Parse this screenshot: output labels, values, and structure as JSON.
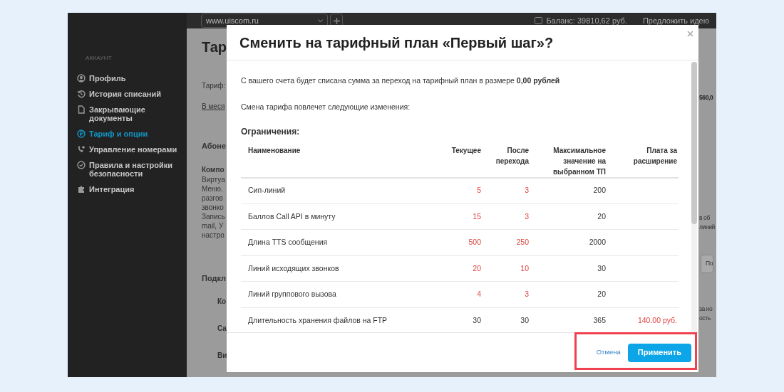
{
  "sidebar": {
    "section": "АККАУНТ",
    "items": [
      {
        "label": "Профиль",
        "kind": "profile",
        "selected": false
      },
      {
        "label": "История списаний",
        "kind": "history",
        "selected": false
      },
      {
        "label": "Закрывающие документы",
        "kind": "document",
        "selected": false
      },
      {
        "label": "Тариф и опции",
        "kind": "tariff",
        "selected": true
      },
      {
        "label": "Управление номерами",
        "kind": "phone",
        "selected": false
      },
      {
        "label": "Правила и настройки безопасности",
        "kind": "shield",
        "selected": false
      },
      {
        "label": "Интеграция",
        "kind": "integration",
        "selected": false
      }
    ]
  },
  "top_bar": {
    "site_select": "www.uiscom.ru",
    "balance": "Баланс: 39810,62 руб.",
    "idea_link": "Предложить идею"
  },
  "background_page": {
    "left_texts": [
      {
        "text": "Тар",
        "kind": "heading"
      },
      {
        "text": "Тариф:",
        "kind": "label"
      },
      {
        "text": "В меся",
        "kind": "link"
      },
      {
        "text": "Абоне",
        "kind": "subheading"
      },
      {
        "text": "Компо",
        "kind": "bold"
      },
      {
        "text": "Виртуа",
        "kind": "line"
      },
      {
        "text": "Меню.",
        "kind": "line"
      },
      {
        "text": "разгов",
        "kind": "line"
      },
      {
        "text": "звонко",
        "kind": "line"
      },
      {
        "text": "Запись",
        "kind": "line"
      },
      {
        "text": "mail, У",
        "kind": "line"
      },
      {
        "text": "настро",
        "kind": "line"
      },
      {
        "text": "Подкл",
        "kind": "subheading"
      },
      {
        "text": "Ко",
        "kind": "option"
      },
      {
        "text": "Са",
        "kind": "option"
      },
      {
        "text": "Ви",
        "kind": "option"
      }
    ],
    "right_texts": [
      {
        "text": "560,0",
        "kind": "price"
      },
      {
        "text": "в об",
        "kind": "line"
      },
      {
        "text": "линий",
        "kind": "line"
      },
      {
        "text": "По",
        "kind": "button"
      },
      {
        "text": "за но",
        "kind": "line"
      },
      {
        "text": "ость",
        "kind": "line"
      }
    ]
  },
  "dialog": {
    "title": "Сменить на тарифный план «Первый шаг»?",
    "message": "С вашего счета будет списана сумма за переход на тарифный план в размере **0,00 рублей**",
    "changes_note": "Смена тарифа повлечет следующие изменения:",
    "section": "Ограничения:",
    "table": {
      "columns": [
        "Наименование",
        "Текущее",
        "После перехода",
        "Максимальное значение на выбранном ТП",
        "Плата за расширение"
      ],
      "rows": [
        {
          "name": "Сип-линий",
          "current": "5",
          "after": "3",
          "max": "200",
          "reduced": true
        },
        {
          "name": "Баллов Call API в минуту",
          "current": "15",
          "after": "3",
          "max": "20",
          "reduced": true
        },
        {
          "name": "Длина TTS сообщения",
          "current": "500",
          "after": "250",
          "max": "2000",
          "reduced": true
        },
        {
          "name": "Линий исходящих звонков",
          "current": "20",
          "after": "10",
          "max": "30",
          "reduced": true
        },
        {
          "name": "Линий группового вызова",
          "current": "4",
          "after": "3",
          "max": "20",
          "reduced": true
        },
        {
          "name": "Длительность хранения файлов на FTP",
          "current": "30",
          "after": "30",
          "max": "365",
          "fee": "140.00 руб.",
          "reduced": false
        }
      ]
    },
    "buttons": [
      {
        "label": "Отмена",
        "kind": "link"
      },
      {
        "label": "Применить",
        "kind": "primary"
      }
    ]
  }
}
